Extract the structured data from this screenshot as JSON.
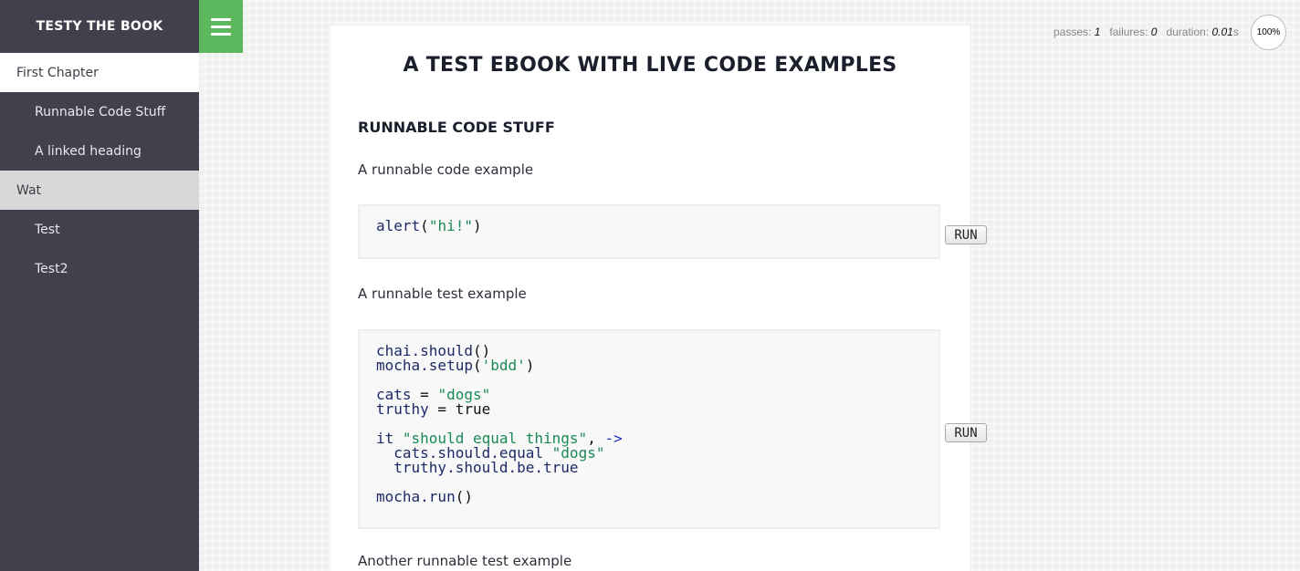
{
  "sidebar": {
    "brand": "TESTY THE BOOK",
    "items": [
      {
        "label": "First Chapter",
        "level": "chapter",
        "state": "active"
      },
      {
        "label": "Runnable Code Stuff",
        "level": "section",
        "state": ""
      },
      {
        "label": "A linked heading",
        "level": "section",
        "state": ""
      },
      {
        "label": "Wat",
        "level": "chapter",
        "state": "current"
      },
      {
        "label": "Test",
        "level": "section",
        "state": ""
      },
      {
        "label": "Test2",
        "level": "section",
        "state": ""
      }
    ]
  },
  "stats": {
    "passes_label": "passes:",
    "passes": "1",
    "failures_label": "failures:",
    "failures": "0",
    "duration_label": "duration:",
    "duration": "0.01",
    "duration_unit": "s",
    "progress": "100%"
  },
  "content": {
    "book_title": "A TEST EBOOK WITH LIVE CODE EXAMPLES",
    "section_title": "RUNNABLE CODE STUFF",
    "para1": "A runnable code example",
    "para2": "A runnable test example",
    "para3": "Another runnable test example",
    "run_label": "RUN",
    "code1": {
      "fn": "alert",
      "open": "(",
      "str": "\"hi!\"",
      "close": ")"
    },
    "code2": {
      "l1_fn": "chai.should",
      "l1_p": "()",
      "l2_fn": "mocha.setup",
      "l2_open": "(",
      "l2_str": "'bdd'",
      "l2_close": ")",
      "l3_var": "cats",
      "l3_eq": " = ",
      "l3_str": "\"dogs\"",
      "l4_var": "truthy",
      "l4_eq": " = ",
      "l4_val": "true",
      "l5_kw": "it",
      "l5_str": " \"should equal things\"",
      "l5_comma": ",",
      "l5_arrow": " ->",
      "l6_fn": "  cats.should.equal",
      "l6_str": " \"dogs\"",
      "l7_fn": "  truthy.should.be.true",
      "l8_fn": "mocha.run",
      "l8_p": "()"
    }
  },
  "colors": {
    "sidebar_bg": "#41414d",
    "menu_toggle": "#5cb85c",
    "string": "#1a8a55",
    "identifier": "#1d2a66",
    "arrow": "#1c2fc0"
  }
}
